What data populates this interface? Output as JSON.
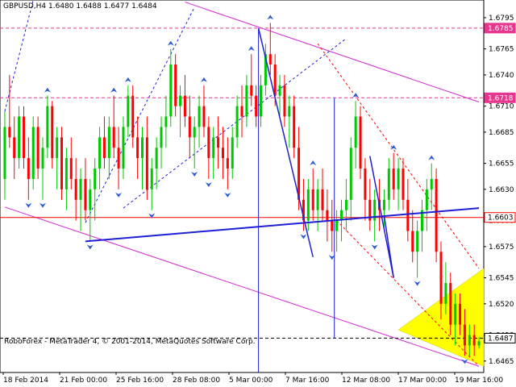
{
  "header": {
    "symbol_line": "GBPUSD,H4  1.6480 1.6488 1.6477 1.6484"
  },
  "footer": {
    "copyright": "RoboForex - MetaTrader 4, © 2001-2014, MetaQuotes Software Corp."
  },
  "colors": {
    "background": "#ffffff",
    "bull": "#00c800",
    "bear": "#ff0000",
    "trendline": "#1f1fd6",
    "channel": "#d22bd2",
    "level": "#e8368f",
    "triangle": "#ffff00",
    "fractal": "#2a5bd7",
    "price_label_bg": "#ffffff"
  },
  "chart_data": {
    "type": "candlestick",
    "symbol": "GBPUSD",
    "timeframe": "H4",
    "ohlc_current": {
      "open": 1.648,
      "high": 1.6488,
      "low": 1.6477,
      "close": 1.6484
    },
    "ylim": [
      1.6454,
      1.6812
    ],
    "y_ticks": [
      "1.6795",
      "1.6765",
      "1.6740",
      "1.6710",
      "1.6685",
      "1.6655",
      "1.6630",
      "1.6600",
      "1.6575",
      "1.6545",
      "1.6520",
      "1.6490",
      "1.6465"
    ],
    "x_ticks": [
      "18 Feb 2014",
      "21 Feb 00:00",
      "25 Feb 16:00",
      "28 Feb 08:00",
      "5 Mar 00:00",
      "7 Mar 16:00",
      "12 Mar 08:00",
      "17 Mar 00:00",
      "19 Mar 16:00"
    ],
    "levels": [
      {
        "label": "1.6785",
        "value": 1.6785,
        "style": "dashed"
      },
      {
        "label": "1.6718",
        "value": 1.6718,
        "style": "dashed"
      },
      {
        "label": "1.6603",
        "value": 1.6603,
        "style": "solid"
      },
      {
        "label": "1.6487",
        "value": 1.6487,
        "style": "dashed"
      }
    ],
    "candles": [
      [
        1.664,
        1.6705,
        1.662,
        1.669
      ],
      [
        1.669,
        1.674,
        1.667,
        1.668
      ],
      [
        1.668,
        1.67,
        1.664,
        1.666
      ],
      [
        1.666,
        1.671,
        1.665,
        1.67
      ],
      [
        1.67,
        1.671,
        1.665,
        1.666
      ],
      [
        1.666,
        1.668,
        1.662,
        1.664
      ],
      [
        1.664,
        1.67,
        1.663,
        1.669
      ],
      [
        1.669,
        1.67,
        1.664,
        1.665
      ],
      [
        1.665,
        1.668,
        1.662,
        1.667
      ],
      [
        1.667,
        1.672,
        1.666,
        1.671
      ],
      [
        1.671,
        1.6715,
        1.665,
        1.666
      ],
      [
        1.666,
        1.669,
        1.663,
        1.668
      ],
      [
        1.668,
        1.669,
        1.662,
        1.663
      ],
      [
        1.663,
        1.667,
        1.661,
        1.666
      ],
      [
        1.666,
        1.668,
        1.663,
        1.664
      ],
      [
        1.664,
        1.666,
        1.66,
        1.662
      ],
      [
        1.662,
        1.665,
        1.659,
        1.664
      ],
      [
        1.664,
        1.666,
        1.66,
        1.661
      ],
      [
        1.661,
        1.664,
        1.658,
        1.663
      ],
      [
        1.663,
        1.666,
        1.66,
        1.665
      ],
      [
        1.665,
        1.669,
        1.663,
        1.668
      ],
      [
        1.668,
        1.67,
        1.665,
        1.666
      ],
      [
        1.666,
        1.67,
        1.664,
        1.669
      ],
      [
        1.669,
        1.672,
        1.666,
        1.667
      ],
      [
        1.667,
        1.669,
        1.663,
        1.665
      ],
      [
        1.665,
        1.67,
        1.664,
        1.669
      ],
      [
        1.669,
        1.673,
        1.668,
        1.672
      ],
      [
        1.672,
        1.673,
        1.667,
        1.668
      ],
      [
        1.668,
        1.67,
        1.664,
        1.666
      ],
      [
        1.666,
        1.669,
        1.663,
        1.668
      ],
      [
        1.668,
        1.67,
        1.662,
        1.663
      ],
      [
        1.663,
        1.666,
        1.661,
        1.665
      ],
      [
        1.665,
        1.668,
        1.663,
        1.667
      ],
      [
        1.667,
        1.67,
        1.665,
        1.669
      ],
      [
        1.669,
        1.672,
        1.667,
        1.67
      ],
      [
        1.67,
        1.6765,
        1.669,
        1.675
      ],
      [
        1.675,
        1.676,
        1.67,
        1.671
      ],
      [
        1.671,
        1.673,
        1.668,
        1.672
      ],
      [
        1.672,
        1.674,
        1.669,
        1.67
      ],
      [
        1.67,
        1.672,
        1.666,
        1.668
      ],
      [
        1.668,
        1.67,
        1.665,
        1.669
      ],
      [
        1.669,
        1.672,
        1.667,
        1.671
      ],
      [
        1.671,
        1.673,
        1.668,
        1.669
      ],
      [
        1.669,
        1.67,
        1.664,
        1.666
      ],
      [
        1.666,
        1.669,
        1.664,
        1.668
      ],
      [
        1.668,
        1.67,
        1.665,
        1.667
      ],
      [
        1.667,
        1.669,
        1.664,
        1.666
      ],
      [
        1.666,
        1.668,
        1.663,
        1.665
      ],
      [
        1.665,
        1.669,
        1.664,
        1.668
      ],
      [
        1.668,
        1.672,
        1.667,
        1.671
      ],
      [
        1.671,
        1.673,
        1.668,
        1.67
      ],
      [
        1.67,
        1.674,
        1.669,
        1.673
      ],
      [
        1.673,
        1.676,
        1.671,
        1.672
      ],
      [
        1.672,
        1.673,
        1.669,
        1.67
      ],
      [
        1.67,
        1.674,
        1.669,
        1.673
      ],
      [
        1.673,
        1.677,
        1.672,
        1.676
      ],
      [
        1.676,
        1.679,
        1.674,
        1.675
      ],
      [
        1.675,
        1.676,
        1.671,
        1.672
      ],
      [
        1.672,
        1.674,
        1.67,
        1.673
      ],
      [
        1.673,
        1.674,
        1.669,
        1.67
      ],
      [
        1.67,
        1.672,
        1.667,
        1.671
      ],
      [
        1.671,
        1.672,
        1.666,
        1.667
      ],
      [
        1.667,
        1.669,
        1.661,
        1.662
      ],
      [
        1.662,
        1.664,
        1.659,
        1.66
      ],
      [
        1.66,
        1.664,
        1.659,
        1.663
      ],
      [
        1.663,
        1.665,
        1.66,
        1.661
      ],
      [
        1.661,
        1.664,
        1.659,
        1.663
      ],
      [
        1.663,
        1.665,
        1.66,
        1.661
      ],
      [
        1.661,
        1.663,
        1.658,
        1.66
      ],
      [
        1.66,
        1.662,
        1.657,
        1.659
      ],
      [
        1.659,
        1.661,
        1.657,
        1.66
      ],
      [
        1.66,
        1.662,
        1.658,
        1.661
      ],
      [
        1.661,
        1.664,
        1.659,
        1.662
      ],
      [
        1.662,
        1.668,
        1.66,
        1.667
      ],
      [
        1.667,
        1.6715,
        1.665,
        1.67
      ],
      [
        1.67,
        1.671,
        1.664,
        1.665
      ],
      [
        1.665,
        1.666,
        1.66,
        1.662
      ],
      [
        1.662,
        1.664,
        1.659,
        1.66
      ],
      [
        1.66,
        1.663,
        1.658,
        1.662
      ],
      [
        1.662,
        1.664,
        1.659,
        1.661
      ],
      [
        1.661,
        1.663,
        1.659,
        1.662
      ],
      [
        1.662,
        1.666,
        1.661,
        1.665
      ],
      [
        1.665,
        1.6665,
        1.662,
        1.663
      ],
      [
        1.663,
        1.666,
        1.661,
        1.665
      ],
      [
        1.665,
        1.666,
        1.661,
        1.662
      ],
      [
        1.662,
        1.664,
        1.658,
        1.659
      ],
      [
        1.659,
        1.661,
        1.656,
        1.657
      ],
      [
        1.657,
        1.66,
        1.6545,
        1.659
      ],
      [
        1.659,
        1.662,
        1.657,
        1.661
      ],
      [
        1.661,
        1.664,
        1.659,
        1.663
      ],
      [
        1.663,
        1.6655,
        1.661,
        1.664
      ],
      [
        1.664,
        1.665,
        1.656,
        1.657
      ],
      [
        1.657,
        1.658,
        1.6505,
        1.652
      ],
      [
        1.652,
        1.656,
        1.651,
        1.654
      ],
      [
        1.654,
        1.655,
        1.649,
        1.65
      ],
      [
        1.65,
        1.653,
        1.648,
        1.652
      ],
      [
        1.652,
        1.653,
        1.649,
        1.65
      ],
      [
        1.65,
        1.6515,
        1.647,
        1.648
      ],
      [
        1.648,
        1.65,
        1.647,
        1.649
      ],
      [
        1.649,
        1.65,
        1.647,
        1.648
      ],
      [
        1.648,
        1.6488,
        1.6477,
        1.6484
      ]
    ]
  }
}
